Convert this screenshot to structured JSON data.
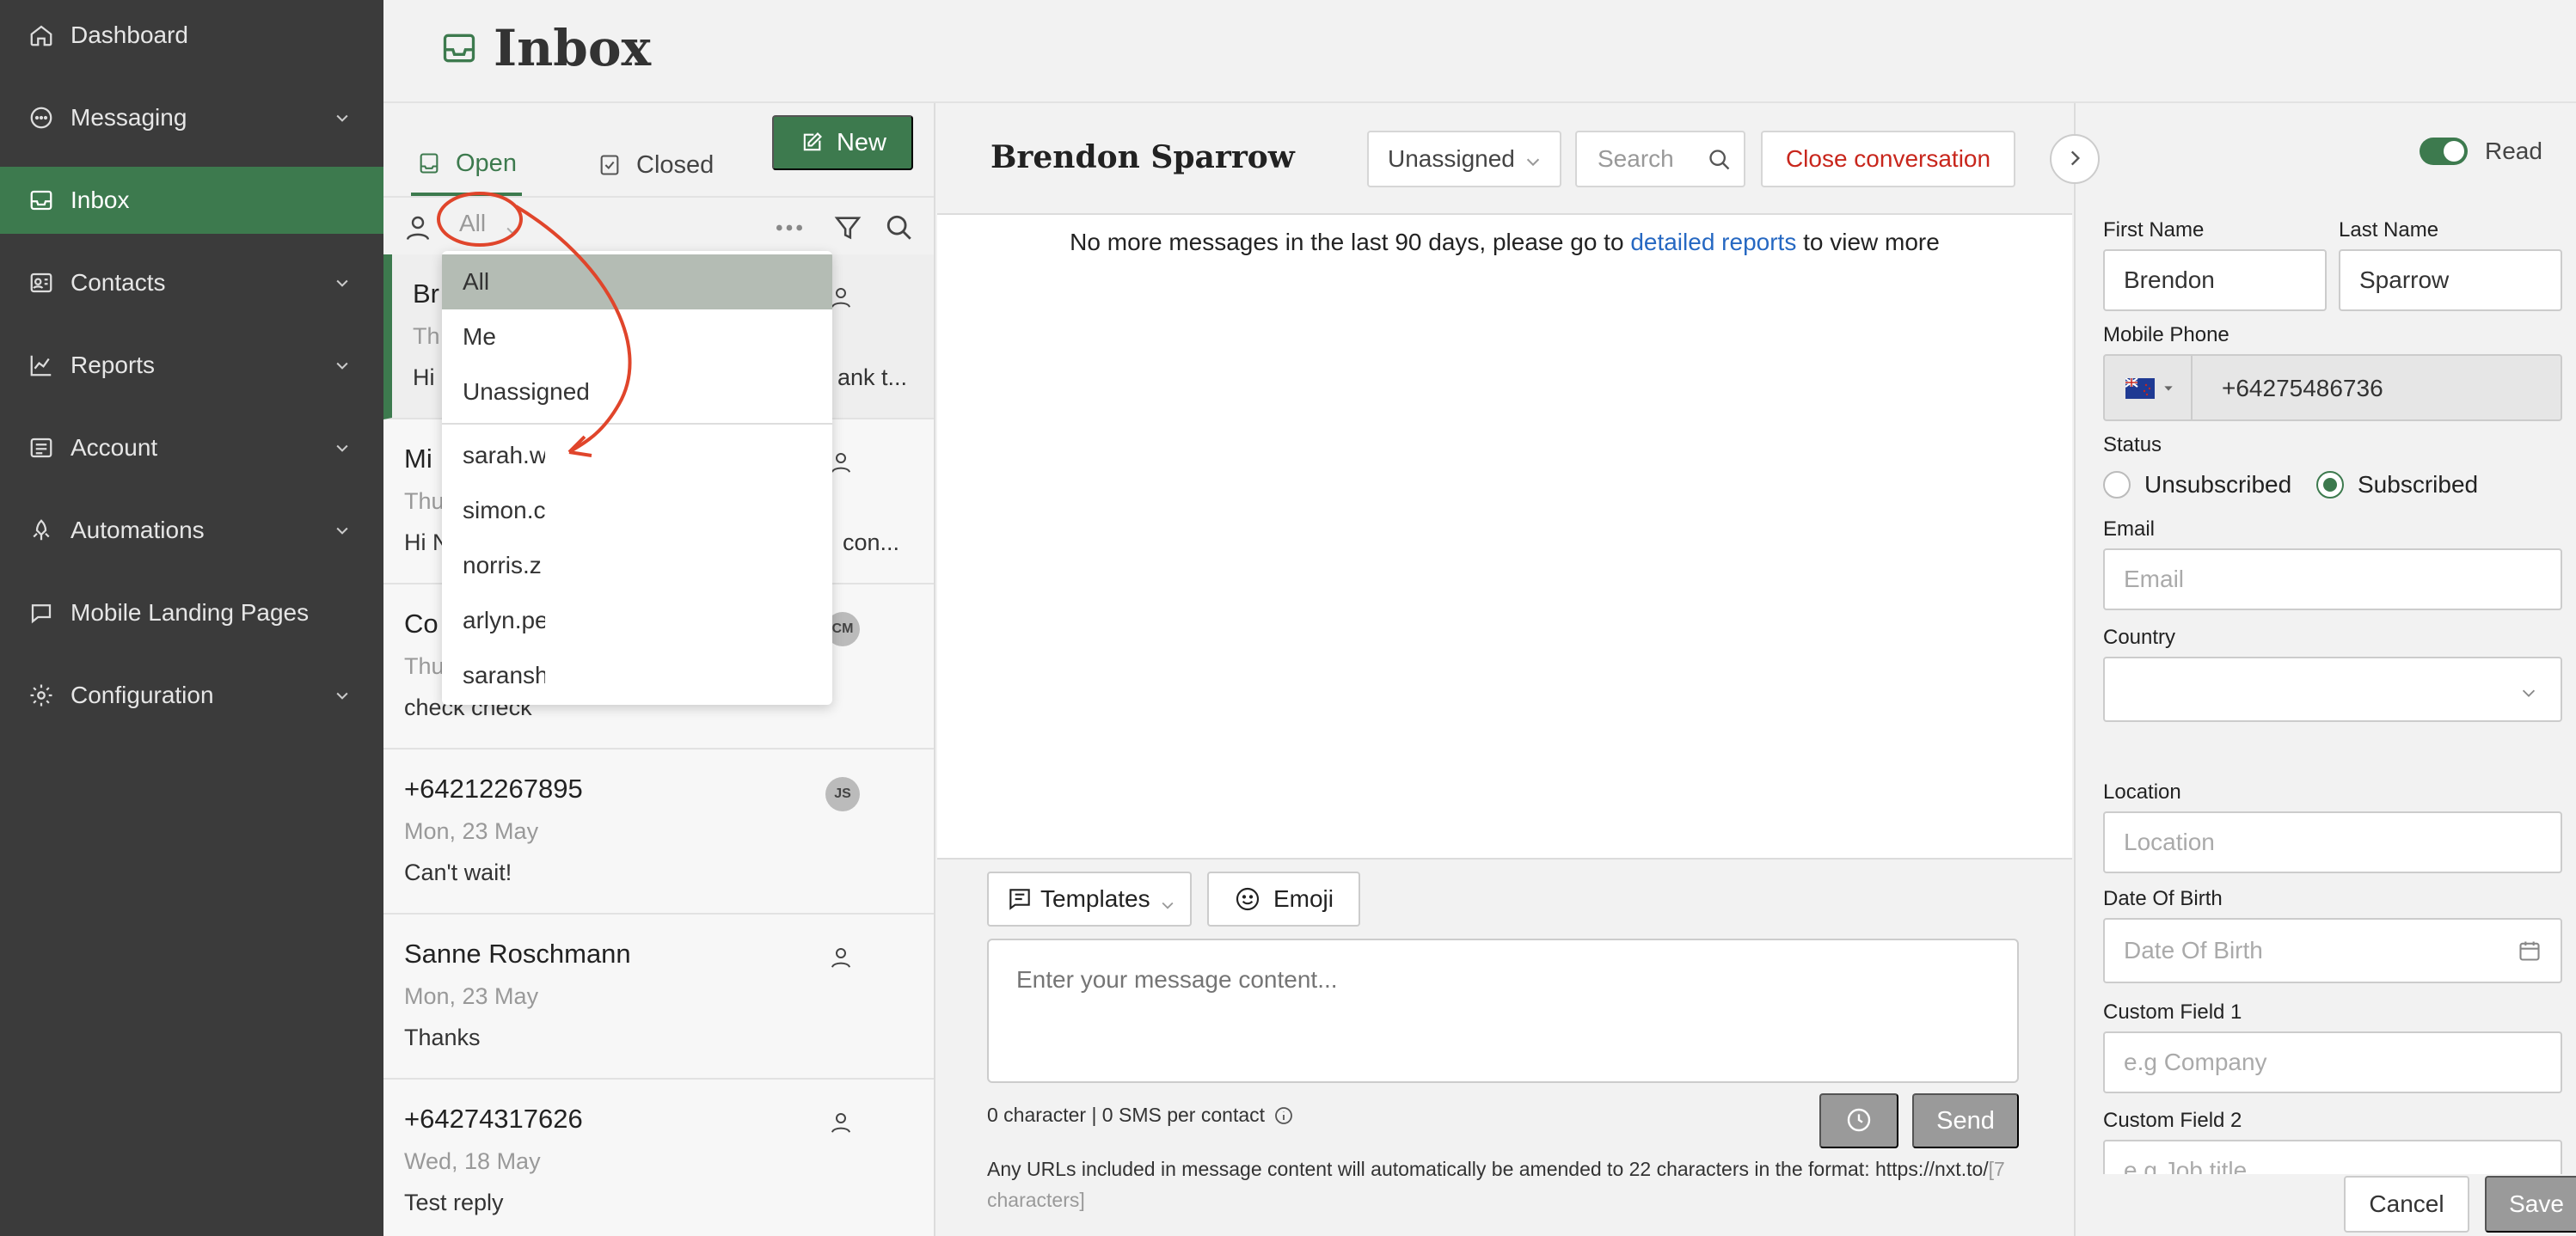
{
  "sidebar": {
    "items": [
      {
        "label": "Dashboard",
        "icon": "home-icon",
        "has_chevron": false
      },
      {
        "label": "Messaging",
        "icon": "chat-icon",
        "has_chevron": true
      },
      {
        "label": "Inbox",
        "icon": "inbox-icon",
        "has_chevron": false,
        "active": true
      },
      {
        "label": "Contacts",
        "icon": "contacts-icon",
        "has_chevron": true
      },
      {
        "label": "Reports",
        "icon": "chart-icon",
        "has_chevron": true
      },
      {
        "label": "Account",
        "icon": "account-icon",
        "has_chevron": true
      },
      {
        "label": "Automations",
        "icon": "automation-icon",
        "has_chevron": true
      },
      {
        "label": "Mobile Landing Pages",
        "icon": "mobile-page-icon",
        "has_chevron": false
      },
      {
        "label": "Configuration",
        "icon": "gear-icon",
        "has_chevron": true
      }
    ]
  },
  "header": {
    "title": "Inbox"
  },
  "list": {
    "tabs": {
      "open": "Open",
      "closed": "Closed"
    },
    "new_label": "New",
    "filter_selected": "All",
    "conversations": [
      {
        "name": "Br",
        "date": "Th",
        "preview": "Hi",
        "preview_right": "ank t...",
        "badge": "person"
      },
      {
        "name": "Mi",
        "date": "Thu",
        "preview": "Hi N",
        "preview_right": "con...",
        "badge": "person"
      },
      {
        "name": "Co",
        "date": "Thu",
        "preview": "check check",
        "preview_right": "",
        "badge": "CM"
      },
      {
        "name": "+64212267895",
        "date": "Mon, 23 May",
        "preview": "Can't wait!",
        "preview_right": "",
        "badge": "JS"
      },
      {
        "name": "Sanne Roschmann",
        "date": "Mon, 23 May",
        "preview": "Thanks",
        "preview_right": "",
        "badge": "person"
      },
      {
        "name": "+64274317626",
        "date": "Wed, 18 May",
        "preview": "Test reply",
        "preview_right": "",
        "badge": "person"
      }
    ]
  },
  "dropdown": {
    "items": [
      "All",
      "Me",
      "Unassigned",
      "sarah.w",
      "simon.c",
      "norris.z",
      "arlyn.pe",
      "saransh"
    ],
    "active_index": 0
  },
  "conversation": {
    "contact_name": "Brendon Sparrow",
    "assignee": "Unassigned",
    "search_placeholder": "Search",
    "close_label": "Close conversation",
    "notice_prefix": "No more messages in the last 90 days, please go to ",
    "notice_link": "detailed reports",
    "notice_suffix": " to view more",
    "templates_label": "Templates",
    "emoji_label": "Emoji",
    "message_placeholder": "Enter your message content...",
    "char_count": "0 character | 0 SMS per contact",
    "send_label": "Send",
    "url_note": "Any URLs included in message content will automatically be amended to 22 characters in the format: https://nxt.to/",
    "url_note_muted": "[7 characters]"
  },
  "contact_panel": {
    "read_label": "Read",
    "read_on": true,
    "first_name_label": "First Name",
    "first_name": "Brendon",
    "last_name_label": "Last Name",
    "last_name": "Sparrow",
    "mobile_label": "Mobile Phone",
    "mobile": "+64275486736",
    "status_label": "Status",
    "unsubscribed_label": "Unsubscribed",
    "subscribed_label": "Subscribed",
    "email_label": "Email",
    "email_placeholder": "Email",
    "country_label": "Country",
    "location_label": "Location",
    "location_placeholder": "Location",
    "dob_label": "Date Of Birth",
    "dob_placeholder": "Date Of Birth",
    "custom1_label": "Custom Field 1",
    "custom1_placeholder": "e.g Company",
    "custom2_label": "Custom Field 2",
    "custom2_placeholder": "e.g Job title",
    "cancel_label": "Cancel",
    "save_label": "Save"
  },
  "colors": {
    "brand_green": "#3d7a4e",
    "sidebar_bg": "#3b3b3b",
    "danger": "#c8261c",
    "link": "#2668c2",
    "annotation": "#e0452b"
  }
}
